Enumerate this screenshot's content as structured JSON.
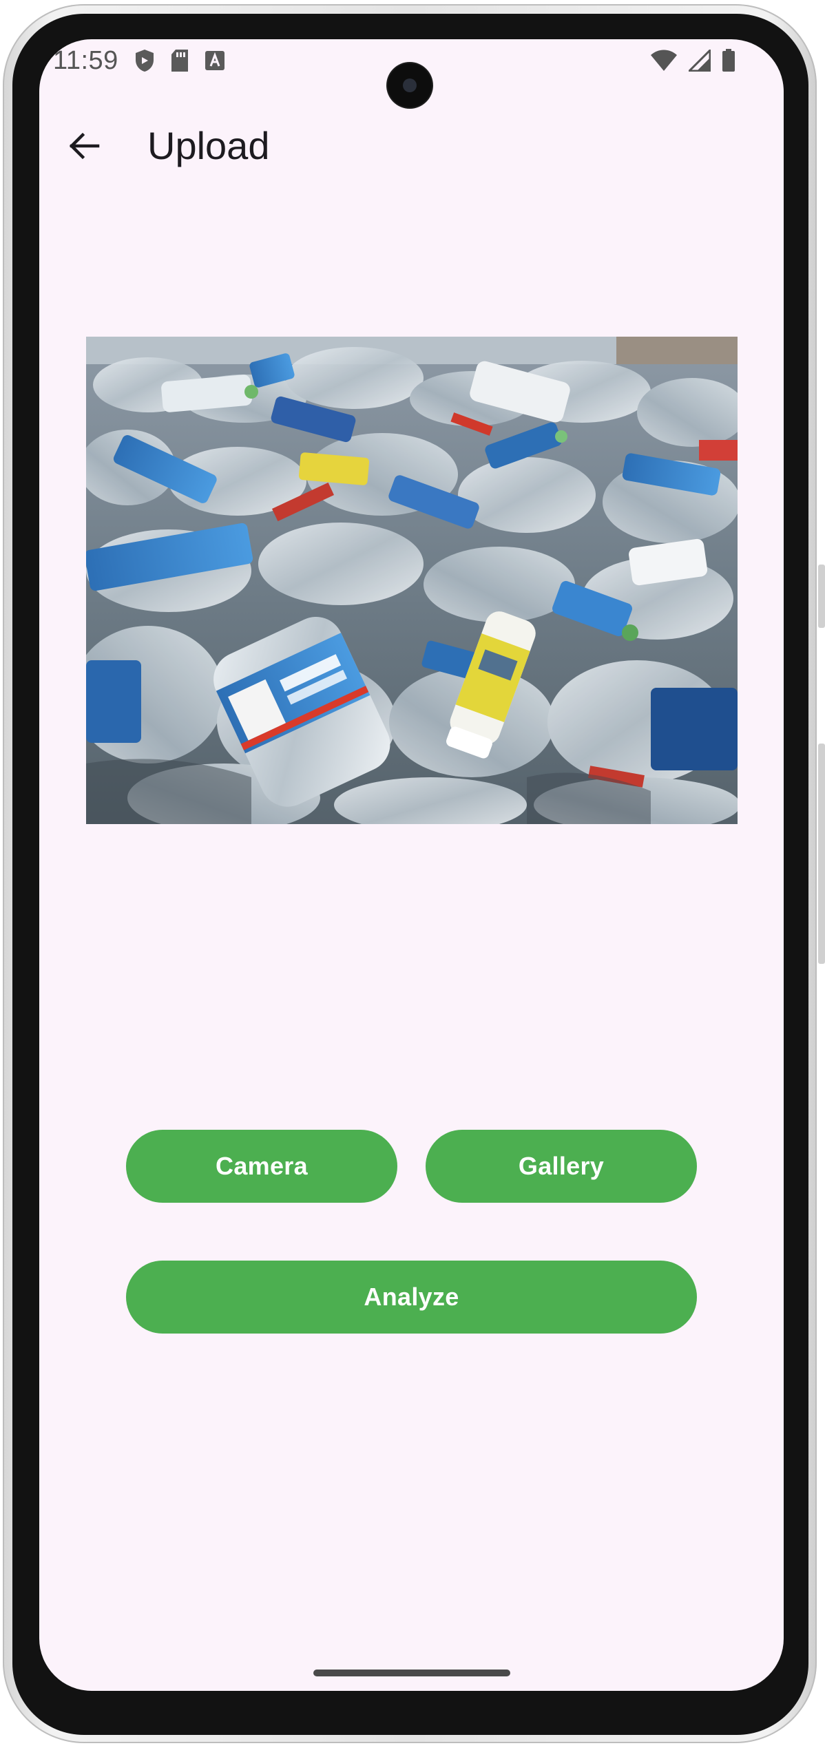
{
  "status_bar": {
    "time": "11:59",
    "left_icons": [
      "shield-icon",
      "sd-card-icon",
      "font-a-icon"
    ],
    "right_icons": [
      "wifi-icon",
      "signal-icon",
      "battery-icon"
    ]
  },
  "app_bar": {
    "title": "Upload",
    "back_icon": "arrow-back-icon"
  },
  "preview": {
    "subject": "pile of plastic bottles"
  },
  "buttons": {
    "camera_label": "Camera",
    "gallery_label": "Gallery",
    "analyze_label": "Analyze"
  },
  "colors": {
    "accent": "#4caf50",
    "background": "#fcf3fb",
    "title_text": "#1d1b20"
  }
}
